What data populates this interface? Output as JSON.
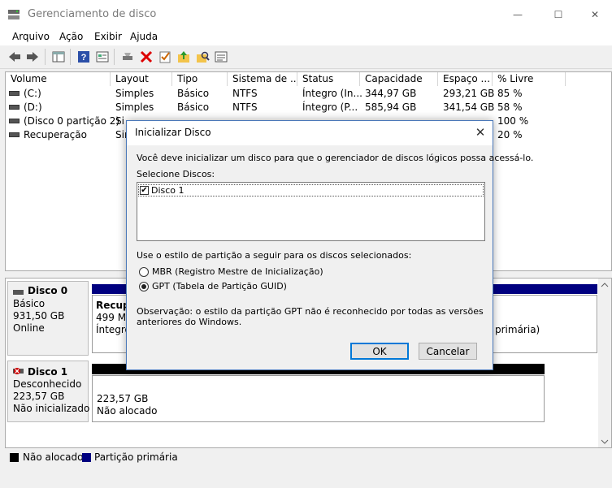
{
  "window": {
    "title": "Gerenciamento de disco",
    "minimize": "—",
    "maximize": "☐",
    "close": "✕"
  },
  "menu": [
    "Arquivo",
    "Ação",
    "Exibir",
    "Ajuda"
  ],
  "volume_table": {
    "columns": [
      "Volume",
      "Layout",
      "Tipo",
      "Sistema de ...",
      "Status",
      "Capacidade",
      "Espaço ...",
      "% Livre"
    ],
    "rows": [
      {
        "volume": "(C:)",
        "layout": "Simples",
        "tipo": "Básico",
        "fs": "NTFS",
        "status": "Íntegro (In...",
        "cap": "344,97 GB",
        "free": "293,21 GB",
        "pct": "85 %"
      },
      {
        "volume": "(D:)",
        "layout": "Simples",
        "tipo": "Básico",
        "fs": "NTFS",
        "status": "Íntegro (P...",
        "cap": "585,94 GB",
        "free": "341,54 GB",
        "pct": "58 %"
      },
      {
        "volume": "(Disco 0 partição 2)",
        "layout": "Si",
        "tipo": "",
        "fs": "",
        "status": "",
        "cap": "",
        "free": "",
        "pct": "100 %"
      },
      {
        "volume": "Recuperação",
        "layout": "Sir",
        "tipo": "",
        "fs": "",
        "status": "",
        "cap": "",
        "free": "",
        "pct": "20 %"
      }
    ]
  },
  "disks": [
    {
      "name": "Disco 0",
      "type": "Básico",
      "size": "931,50 GB",
      "state": "Online",
      "partition": {
        "title": "Recup",
        "size": "499 MB",
        "status": "Íntegro",
        "trailing": "primária)"
      }
    },
    {
      "name": "Disco 1",
      "type": "Desconhecido",
      "size": "223,57 GB",
      "state": "Não inicializado",
      "partition": {
        "size": "223,57 GB",
        "status": "Não alocado"
      }
    }
  ],
  "legend": {
    "unallocated": "Não alocado",
    "primary": "Partição primária",
    "unallocated_color": "#000000",
    "primary_color": "#000080"
  },
  "dialog": {
    "title": "Inicializar Disco",
    "intro": "Você deve inicializar um disco para que o gerenciador de discos lógicos possa acessá-lo.",
    "select_label": "Selecione Discos:",
    "disk_item": "Disco 1",
    "style_label": "Use o estilo de partição a seguir para os discos selecionados:",
    "mbr": "MBR (Registro Mestre de Inicialização)",
    "gpt": "GPT (Tabela de Partição GUID)",
    "note": "Observação: o estilo da partição GPT não é reconhecido por todas as versões anteriores do Windows.",
    "ok": "OK",
    "cancel": "Cancelar"
  }
}
